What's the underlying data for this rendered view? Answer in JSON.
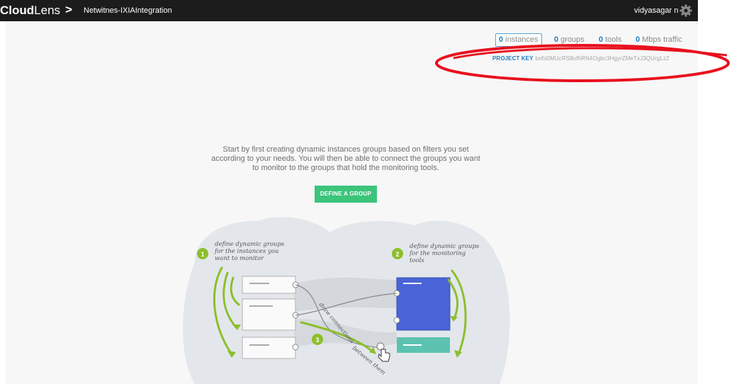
{
  "header": {
    "logo_bold": "Cloud",
    "logo_light": "Lens",
    "separator": ">",
    "project_name": "Netwitnes-IXIAIntegration",
    "username": "vidyasagar n",
    "settings_icon": "gear-icon"
  },
  "stats": {
    "instances": {
      "count": "0",
      "label": "instances"
    },
    "groups": {
      "count": "0",
      "label": "groups"
    },
    "tools": {
      "count": "0",
      "label": "tools"
    },
    "traffic": {
      "count": "0",
      "label": "Mbps traffic"
    }
  },
  "project_key": {
    "label": "PROJECT KEY",
    "value": "bnfo0MUcRS8ofhRN4Ogbc3HgyrZMeTxJ3QUrgLz2"
  },
  "annotation": {
    "ellipse_color": "#e8101d"
  },
  "intro_text": "Start by first creating dynamic instances groups based on filters you set according to your needs. You will then be able to connect the groups you want to monitor to the groups that hold the monitoring tools.",
  "define_group_button": "DEFINE A GROUP",
  "illustration": {
    "step1_number": "1",
    "step1_lines": [
      "define dynamic groups",
      "for the instances you",
      "want to monitor"
    ],
    "step2_number": "2",
    "step2_lines": [
      "define dynamic groups",
      "for the monitoring",
      "tools"
    ],
    "step3_number": "3",
    "step3_lines": [
      "draw connections",
      "between them"
    ]
  },
  "colors": {
    "accent_green": "#3cc47b",
    "step_green": "#8cbf2b",
    "tool_blue": "#4a63d6",
    "tool_teal": "#5cc3b0",
    "link_blue": "#1f7bbf"
  }
}
